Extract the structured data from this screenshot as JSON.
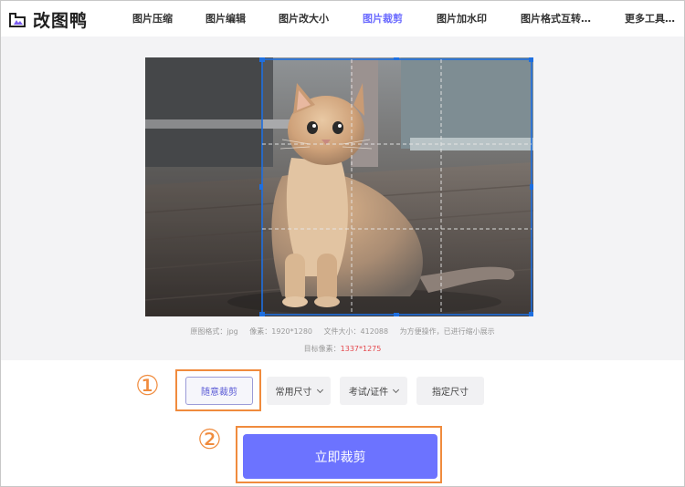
{
  "header": {
    "logo_text": "改图鸭",
    "nav": [
      {
        "label": "图片压缩",
        "active": false
      },
      {
        "label": "图片编辑",
        "active": false
      },
      {
        "label": "图片改大小",
        "active": false
      },
      {
        "label": "图片裁剪",
        "active": true
      },
      {
        "label": "图片加水印",
        "active": false
      },
      {
        "label": "图片格式互转…",
        "active": false
      },
      {
        "label": "更多工具…",
        "active": false
      }
    ]
  },
  "image_info": {
    "format": "原图格式：jpg",
    "pixels": "像素：1920*1280",
    "filesize": "文件大小：412088",
    "note": "为方便操作，已进行缩小展示",
    "target_label": "目标像素：",
    "target_value": "1337*1275"
  },
  "options": {
    "free_crop": "随意裁剪",
    "common_size": "常用尺寸",
    "exam_id": "考试/证件",
    "custom_size": "指定尺寸"
  },
  "cta_label": "立即裁剪",
  "annotations": {
    "step1": "①",
    "step2": "②"
  },
  "colors": {
    "accent": "#6c73ff",
    "highlight": "#f08b3d",
    "crop_frame": "#1e6fe0",
    "target_red": "#e5484d"
  }
}
